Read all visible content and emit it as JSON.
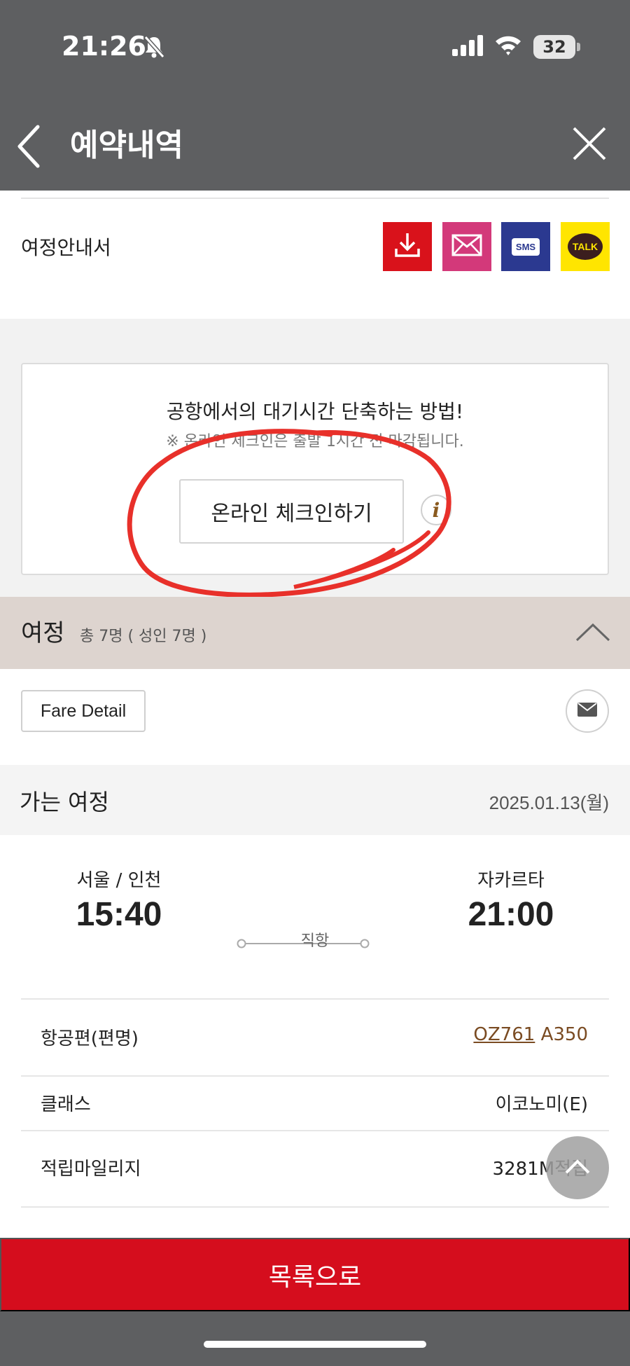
{
  "status_bar": {
    "time": "21:26",
    "battery": "32"
  },
  "header": {
    "title": "예약내역"
  },
  "itinerary_doc": {
    "label": "여정안내서",
    "share_buttons": [
      {
        "icon": "download-icon",
        "color": "#d9121b"
      },
      {
        "icon": "mail-icon",
        "color": "#d3397a"
      },
      {
        "icon": "sms-icon",
        "label": "SMS",
        "color": "#2b3990"
      },
      {
        "icon": "kakaotalk-icon",
        "label": "TALK",
        "color": "#ffe500"
      }
    ]
  },
  "checkin": {
    "title": "공항에서의 대기시간 단축하는 방법!",
    "note": "※ 온라인 체크인은 출발 1시간 전 마감됩니다.",
    "button_label": "온라인 체크인하기",
    "info_glyph": "i"
  },
  "itinerary": {
    "title": "여정",
    "count": "총 7명 ( 성인 7명 )",
    "fare_detail_label": "Fare Detail"
  },
  "outbound": {
    "label": "가는 여정",
    "date": "2025.01.13(월)",
    "departure": {
      "city": "서울 / 인천",
      "time": "15:40"
    },
    "arrival": {
      "city": "자카르타",
      "time": "21:00"
    },
    "route_type": "직항",
    "details": [
      {
        "label": "항공편(편명)",
        "flight": "OZ761",
        "aircraft": "A350"
      },
      {
        "label": "클래스",
        "value": "이코노미(E)"
      },
      {
        "label": "적립마일리지",
        "value": "3281M적립"
      }
    ]
  },
  "footer": {
    "button_label": "목록으로"
  },
  "colors": {
    "brand_red": "#d50d1d",
    "header_gray": "#5e5f61",
    "annotation_red": "#e8302a"
  }
}
